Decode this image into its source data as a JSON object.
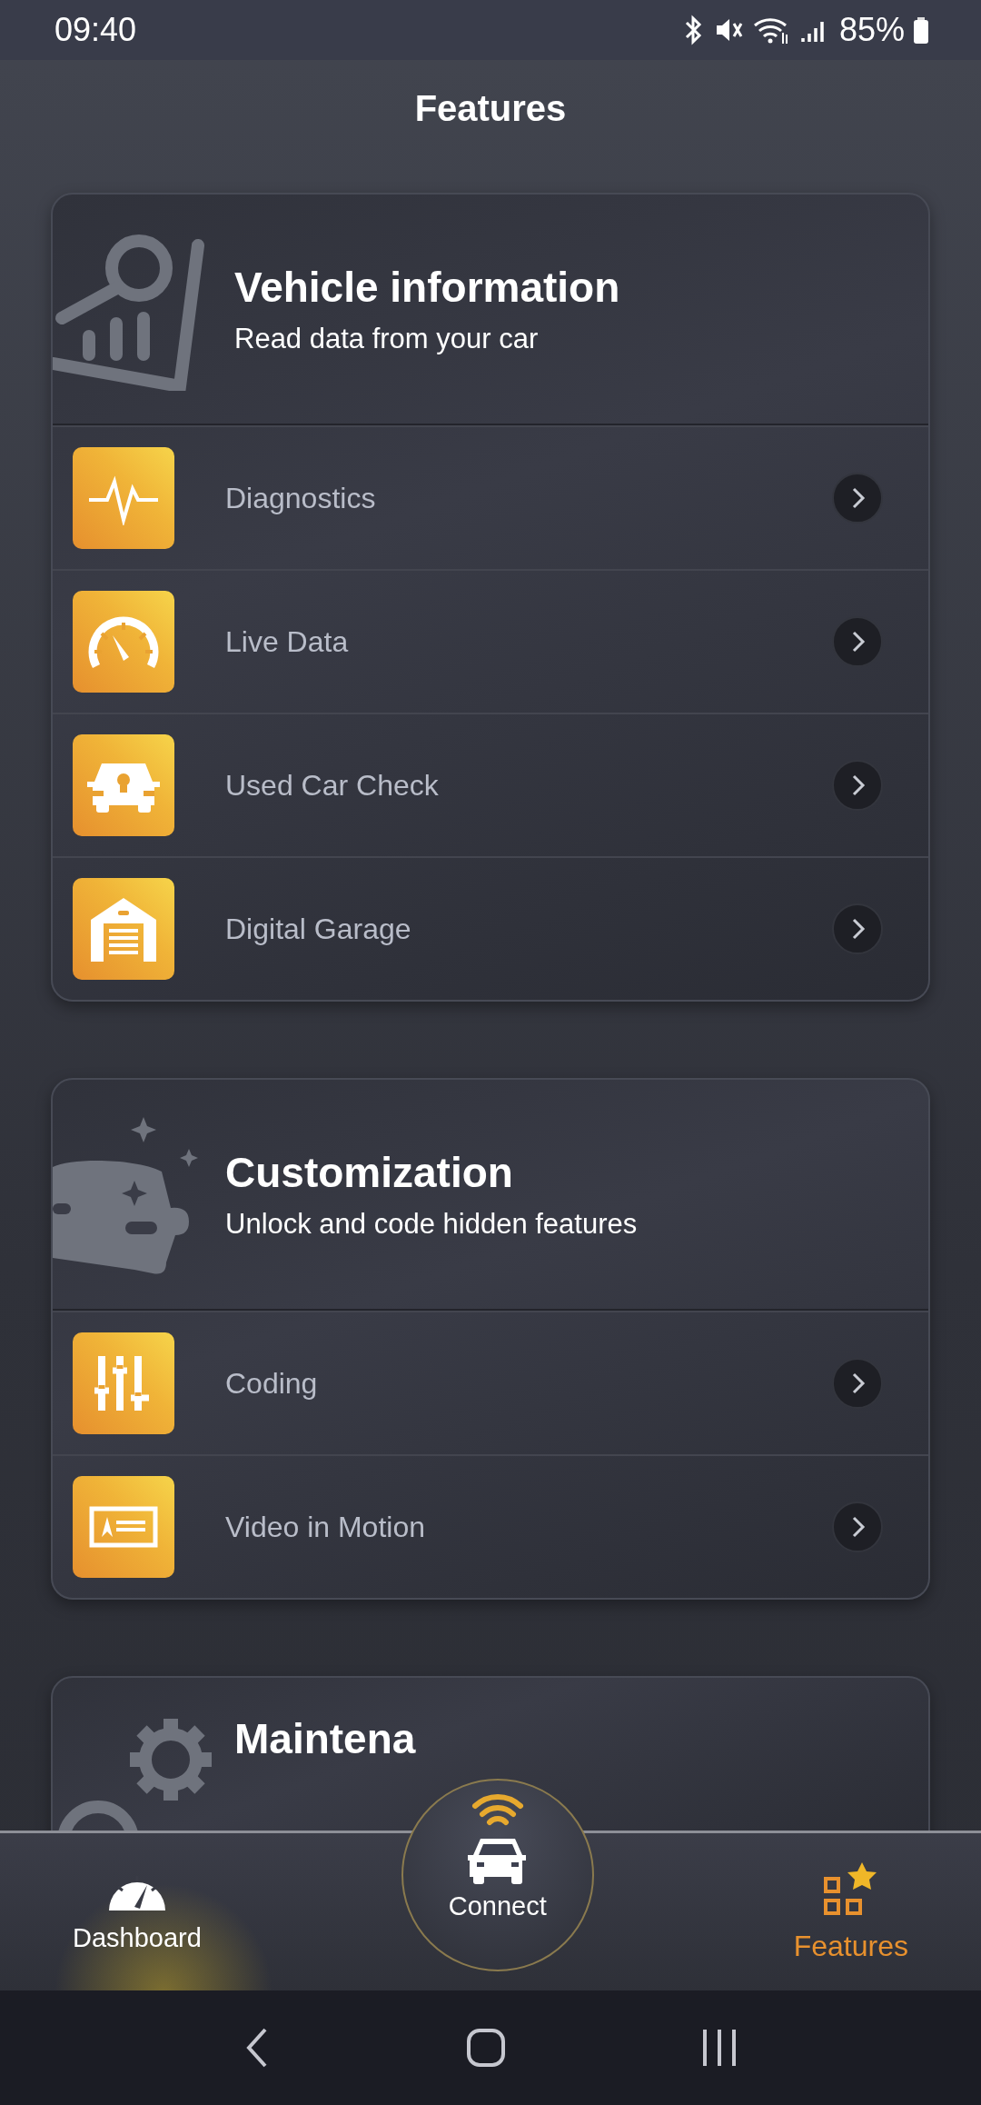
{
  "status_bar": {
    "time": "09:40",
    "battery": "85%"
  },
  "header": {
    "title": "Features"
  },
  "sections": [
    {
      "kind": "report",
      "title": "Vehicle information",
      "subtitle": "Read data from your car",
      "items": [
        {
          "kind": "pulse",
          "label": "Diagnostics"
        },
        {
          "kind": "gauge",
          "label": "Live Data"
        },
        {
          "kind": "car",
          "label": "Used Car Check"
        },
        {
          "kind": "garage",
          "label": "Digital Garage"
        }
      ]
    },
    {
      "kind": "sparkle",
      "title": "Customization",
      "subtitle": "Unlock and code hidden features",
      "items": [
        {
          "kind": "sliders",
          "label": "Coding"
        },
        {
          "kind": "screen",
          "label": "Video in Motion"
        }
      ]
    },
    {
      "kind": "gears",
      "title": "Maintena"
    }
  ],
  "bottom_nav": [
    {
      "kind": "dashboard",
      "label": "Dashboard",
      "selected": false
    },
    {
      "kind": "connect",
      "label": "Connect",
      "selected": false
    },
    {
      "kind": "features",
      "label": "Features",
      "selected": true
    }
  ]
}
